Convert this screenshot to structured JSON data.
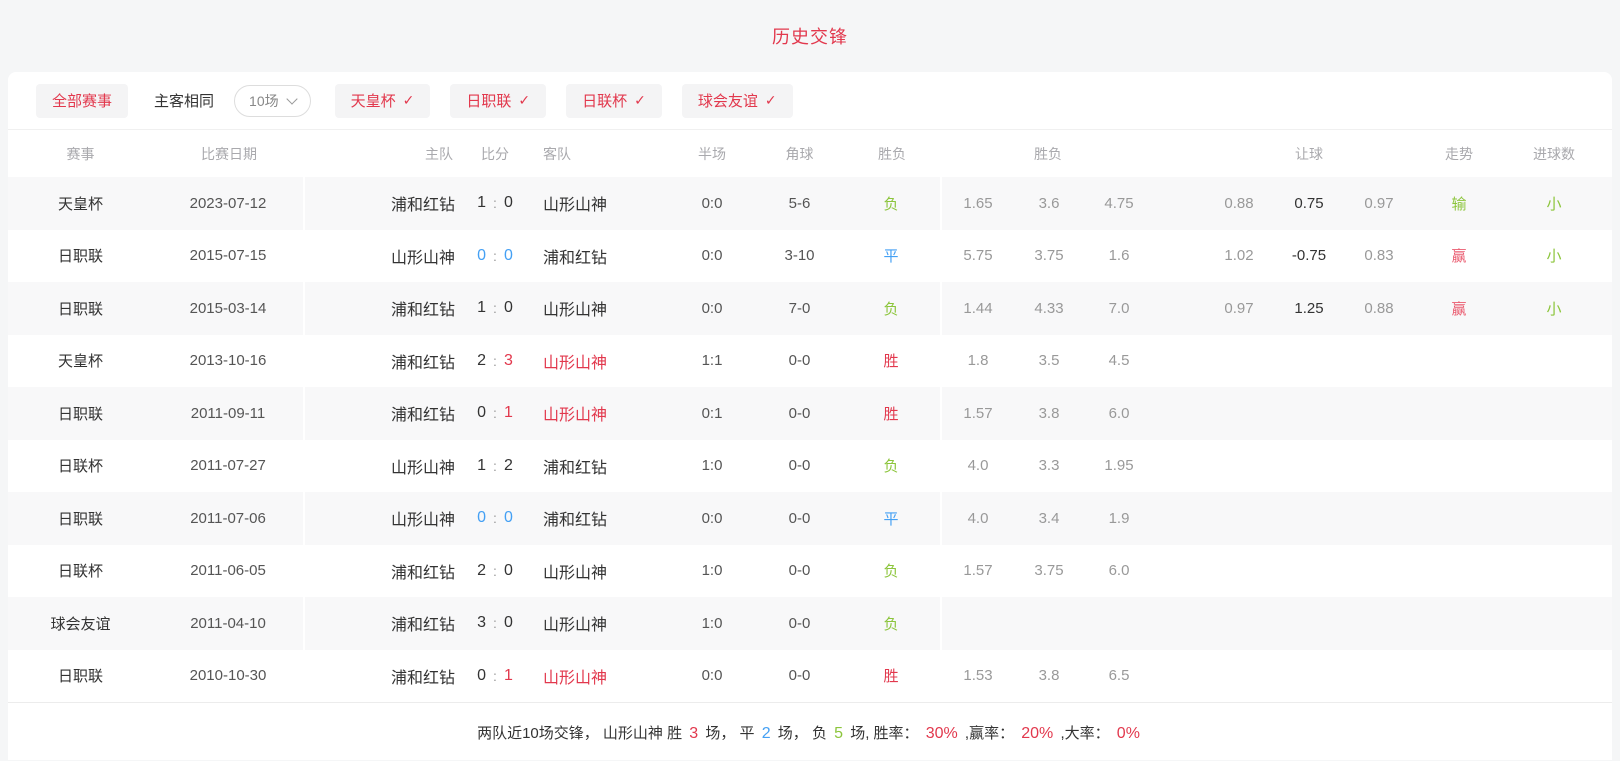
{
  "title": "历史交锋",
  "colors": {
    "accent_red": "#e2384d",
    "win_red": "#ea5b6f",
    "green": "#8cc53c",
    "blue": "#44a0f4"
  },
  "filters": {
    "all_label": "全部赛事",
    "same_venue_label": "主客相同",
    "count_value": "10场",
    "competitions": [
      {
        "label": "天皇杯",
        "checked": true
      },
      {
        "label": "日职联",
        "checked": true
      },
      {
        "label": "日联杯",
        "checked": true
      },
      {
        "label": "球会友谊",
        "checked": true
      }
    ],
    "check_icon": "✓"
  },
  "table": {
    "headers": {
      "event": "赛事",
      "date": "比赛日期",
      "home": "主队",
      "score": "比分",
      "away": "客队",
      "half": "半场",
      "corner": "角球",
      "result": "胜负",
      "odds_group": "胜负",
      "handicap_group": "让球",
      "trend": "走势",
      "goals": "进球数"
    },
    "rows": [
      {
        "event": "天皇杯",
        "date": "2023-07-12",
        "home": "浦和红钻",
        "score": {
          "home": "1",
          "home_cls": "dark",
          "away": "0",
          "away_cls": "dark"
        },
        "away": "山形山神",
        "away_red": false,
        "half": "0:0",
        "corner": "5-6",
        "result": "负",
        "result_cls": "green",
        "odds": [
          "1.65",
          "3.6",
          "4.75"
        ],
        "handicap": [
          "0.88",
          "0.75",
          "0.97"
        ],
        "trend": "输",
        "trend_cls": "green",
        "goals": "小",
        "goals_cls": "green"
      },
      {
        "event": "日职联",
        "date": "2015-07-15",
        "home": "山形山神",
        "score": {
          "home": "0",
          "home_cls": "blue",
          "away": "0",
          "away_cls": "blue"
        },
        "away": "浦和红钻",
        "away_red": false,
        "half": "0:0",
        "corner": "3-10",
        "result": "平",
        "result_cls": "blue",
        "odds": [
          "5.75",
          "3.75",
          "1.6"
        ],
        "handicap": [
          "1.02",
          "-0.75",
          "0.83"
        ],
        "trend": "赢",
        "trend_cls": "winred",
        "goals": "小",
        "goals_cls": "green"
      },
      {
        "event": "日职联",
        "date": "2015-03-14",
        "home": "浦和红钻",
        "score": {
          "home": "1",
          "home_cls": "dark",
          "away": "0",
          "away_cls": "dark"
        },
        "away": "山形山神",
        "away_red": false,
        "half": "0:0",
        "corner": "7-0",
        "result": "负",
        "result_cls": "green",
        "odds": [
          "1.44",
          "4.33",
          "7.0"
        ],
        "handicap": [
          "0.97",
          "1.25",
          "0.88"
        ],
        "trend": "赢",
        "trend_cls": "winred",
        "goals": "小",
        "goals_cls": "green"
      },
      {
        "event": "天皇杯",
        "date": "2013-10-16",
        "home": "浦和红钻",
        "score": {
          "home": "2",
          "home_cls": "dark",
          "away": "3",
          "away_cls": "red"
        },
        "away": "山形山神",
        "away_red": true,
        "half": "1:1",
        "corner": "0-0",
        "result": "胜",
        "result_cls": "red",
        "odds": [
          "1.8",
          "3.5",
          "4.5"
        ],
        "handicap": [
          "",
          "",
          ""
        ],
        "trend": "",
        "trend_cls": "",
        "goals": "",
        "goals_cls": ""
      },
      {
        "event": "日职联",
        "date": "2011-09-11",
        "home": "浦和红钻",
        "score": {
          "home": "0",
          "home_cls": "dark",
          "away": "1",
          "away_cls": "red"
        },
        "away": "山形山神",
        "away_red": true,
        "half": "0:1",
        "corner": "0-0",
        "result": "胜",
        "result_cls": "red",
        "odds": [
          "1.57",
          "3.8",
          "6.0"
        ],
        "handicap": [
          "",
          "",
          ""
        ],
        "trend": "",
        "trend_cls": "",
        "goals": "",
        "goals_cls": ""
      },
      {
        "event": "日联杯",
        "date": "2011-07-27",
        "home": "山形山神",
        "score": {
          "home": "1",
          "home_cls": "dark",
          "away": "2",
          "away_cls": "dark"
        },
        "away": "浦和红钻",
        "away_red": false,
        "half": "1:0",
        "corner": "0-0",
        "result": "负",
        "result_cls": "green",
        "odds": [
          "4.0",
          "3.3",
          "1.95"
        ],
        "handicap": [
          "",
          "",
          ""
        ],
        "trend": "",
        "trend_cls": "",
        "goals": "",
        "goals_cls": ""
      },
      {
        "event": "日职联",
        "date": "2011-07-06",
        "home": "山形山神",
        "score": {
          "home": "0",
          "home_cls": "blue",
          "away": "0",
          "away_cls": "blue"
        },
        "away": "浦和红钻",
        "away_red": false,
        "half": "0:0",
        "corner": "0-0",
        "result": "平",
        "result_cls": "blue",
        "odds": [
          "4.0",
          "3.4",
          "1.9"
        ],
        "handicap": [
          "",
          "",
          ""
        ],
        "trend": "",
        "trend_cls": "",
        "goals": "",
        "goals_cls": ""
      },
      {
        "event": "日联杯",
        "date": "2011-06-05",
        "home": "浦和红钻",
        "score": {
          "home": "2",
          "home_cls": "dark",
          "away": "0",
          "away_cls": "dark"
        },
        "away": "山形山神",
        "away_red": false,
        "half": "1:0",
        "corner": "0-0",
        "result": "负",
        "result_cls": "green",
        "odds": [
          "1.57",
          "3.75",
          "6.0"
        ],
        "handicap": [
          "",
          "",
          ""
        ],
        "trend": "",
        "trend_cls": "",
        "goals": "",
        "goals_cls": ""
      },
      {
        "event": "球会友谊",
        "date": "2011-04-10",
        "home": "浦和红钻",
        "score": {
          "home": "3",
          "home_cls": "dark",
          "away": "0",
          "away_cls": "dark"
        },
        "away": "山形山神",
        "away_red": false,
        "half": "1:0",
        "corner": "0-0",
        "result": "负",
        "result_cls": "green",
        "odds": [
          "",
          "",
          ""
        ],
        "handicap": [
          "",
          "",
          ""
        ],
        "trend": "",
        "trend_cls": "",
        "goals": "",
        "goals_cls": ""
      },
      {
        "event": "日职联",
        "date": "2010-10-30",
        "home": "浦和红钻",
        "score": {
          "home": "0",
          "home_cls": "dark",
          "away": "1",
          "away_cls": "red"
        },
        "away": "山形山神",
        "away_red": true,
        "half": "0:0",
        "corner": "0-0",
        "result": "胜",
        "result_cls": "red",
        "odds": [
          "1.53",
          "3.8",
          "6.5"
        ],
        "handicap": [
          "",
          "",
          ""
        ],
        "trend": "",
        "trend_cls": "",
        "goals": "",
        "goals_cls": ""
      }
    ]
  },
  "summary": {
    "segments": [
      {
        "text": "两队近10场交锋，  山形山神 胜 ",
        "cls": "dark",
        "num": false
      },
      {
        "text": "3",
        "cls": "red",
        "num": true
      },
      {
        "text": " 场，  平 ",
        "cls": "dark",
        "num": false
      },
      {
        "text": "2",
        "cls": "blue",
        "num": true
      },
      {
        "text": " 场，  负 ",
        "cls": "dark",
        "num": false
      },
      {
        "text": "5",
        "cls": "green",
        "num": true
      },
      {
        "text": " 场, 胜率：  ",
        "cls": "dark",
        "num": false
      },
      {
        "text": "30%",
        "cls": "red",
        "num": true
      },
      {
        "text": " ,赢率：  ",
        "cls": "dark",
        "num": false
      },
      {
        "text": "20%",
        "cls": "red",
        "num": true
      },
      {
        "text": " ,大率：  ",
        "cls": "dark",
        "num": false
      },
      {
        "text": "0%",
        "cls": "red",
        "num": true
      }
    ]
  }
}
